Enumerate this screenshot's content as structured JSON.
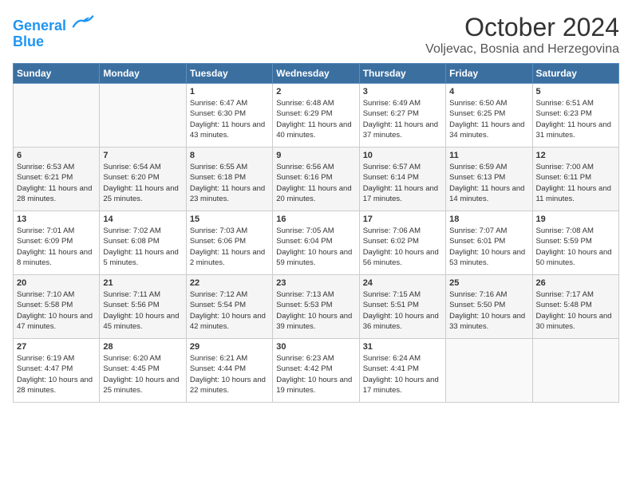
{
  "logo": {
    "line1": "General",
    "line2": "Blue"
  },
  "title": "October 2024",
  "location": "Voljevac, Bosnia and Herzegovina",
  "weekdays": [
    "Sunday",
    "Monday",
    "Tuesday",
    "Wednesday",
    "Thursday",
    "Friday",
    "Saturday"
  ],
  "weeks": [
    [
      {
        "day": "",
        "sunrise": "",
        "sunset": "",
        "daylight": ""
      },
      {
        "day": "",
        "sunrise": "",
        "sunset": "",
        "daylight": ""
      },
      {
        "day": "1",
        "sunrise": "Sunrise: 6:47 AM",
        "sunset": "Sunset: 6:30 PM",
        "daylight": "Daylight: 11 hours and 43 minutes."
      },
      {
        "day": "2",
        "sunrise": "Sunrise: 6:48 AM",
        "sunset": "Sunset: 6:29 PM",
        "daylight": "Daylight: 11 hours and 40 minutes."
      },
      {
        "day": "3",
        "sunrise": "Sunrise: 6:49 AM",
        "sunset": "Sunset: 6:27 PM",
        "daylight": "Daylight: 11 hours and 37 minutes."
      },
      {
        "day": "4",
        "sunrise": "Sunrise: 6:50 AM",
        "sunset": "Sunset: 6:25 PM",
        "daylight": "Daylight: 11 hours and 34 minutes."
      },
      {
        "day": "5",
        "sunrise": "Sunrise: 6:51 AM",
        "sunset": "Sunset: 6:23 PM",
        "daylight": "Daylight: 11 hours and 31 minutes."
      }
    ],
    [
      {
        "day": "6",
        "sunrise": "Sunrise: 6:53 AM",
        "sunset": "Sunset: 6:21 PM",
        "daylight": "Daylight: 11 hours and 28 minutes."
      },
      {
        "day": "7",
        "sunrise": "Sunrise: 6:54 AM",
        "sunset": "Sunset: 6:20 PM",
        "daylight": "Daylight: 11 hours and 25 minutes."
      },
      {
        "day": "8",
        "sunrise": "Sunrise: 6:55 AM",
        "sunset": "Sunset: 6:18 PM",
        "daylight": "Daylight: 11 hours and 23 minutes."
      },
      {
        "day": "9",
        "sunrise": "Sunrise: 6:56 AM",
        "sunset": "Sunset: 6:16 PM",
        "daylight": "Daylight: 11 hours and 20 minutes."
      },
      {
        "day": "10",
        "sunrise": "Sunrise: 6:57 AM",
        "sunset": "Sunset: 6:14 PM",
        "daylight": "Daylight: 11 hours and 17 minutes."
      },
      {
        "day": "11",
        "sunrise": "Sunrise: 6:59 AM",
        "sunset": "Sunset: 6:13 PM",
        "daylight": "Daylight: 11 hours and 14 minutes."
      },
      {
        "day": "12",
        "sunrise": "Sunrise: 7:00 AM",
        "sunset": "Sunset: 6:11 PM",
        "daylight": "Daylight: 11 hours and 11 minutes."
      }
    ],
    [
      {
        "day": "13",
        "sunrise": "Sunrise: 7:01 AM",
        "sunset": "Sunset: 6:09 PM",
        "daylight": "Daylight: 11 hours and 8 minutes."
      },
      {
        "day": "14",
        "sunrise": "Sunrise: 7:02 AM",
        "sunset": "Sunset: 6:08 PM",
        "daylight": "Daylight: 11 hours and 5 minutes."
      },
      {
        "day": "15",
        "sunrise": "Sunrise: 7:03 AM",
        "sunset": "Sunset: 6:06 PM",
        "daylight": "Daylight: 11 hours and 2 minutes."
      },
      {
        "day": "16",
        "sunrise": "Sunrise: 7:05 AM",
        "sunset": "Sunset: 6:04 PM",
        "daylight": "Daylight: 10 hours and 59 minutes."
      },
      {
        "day": "17",
        "sunrise": "Sunrise: 7:06 AM",
        "sunset": "Sunset: 6:02 PM",
        "daylight": "Daylight: 10 hours and 56 minutes."
      },
      {
        "day": "18",
        "sunrise": "Sunrise: 7:07 AM",
        "sunset": "Sunset: 6:01 PM",
        "daylight": "Daylight: 10 hours and 53 minutes."
      },
      {
        "day": "19",
        "sunrise": "Sunrise: 7:08 AM",
        "sunset": "Sunset: 5:59 PM",
        "daylight": "Daylight: 10 hours and 50 minutes."
      }
    ],
    [
      {
        "day": "20",
        "sunrise": "Sunrise: 7:10 AM",
        "sunset": "Sunset: 5:58 PM",
        "daylight": "Daylight: 10 hours and 47 minutes."
      },
      {
        "day": "21",
        "sunrise": "Sunrise: 7:11 AM",
        "sunset": "Sunset: 5:56 PM",
        "daylight": "Daylight: 10 hours and 45 minutes."
      },
      {
        "day": "22",
        "sunrise": "Sunrise: 7:12 AM",
        "sunset": "Sunset: 5:54 PM",
        "daylight": "Daylight: 10 hours and 42 minutes."
      },
      {
        "day": "23",
        "sunrise": "Sunrise: 7:13 AM",
        "sunset": "Sunset: 5:53 PM",
        "daylight": "Daylight: 10 hours and 39 minutes."
      },
      {
        "day": "24",
        "sunrise": "Sunrise: 7:15 AM",
        "sunset": "Sunset: 5:51 PM",
        "daylight": "Daylight: 10 hours and 36 minutes."
      },
      {
        "day": "25",
        "sunrise": "Sunrise: 7:16 AM",
        "sunset": "Sunset: 5:50 PM",
        "daylight": "Daylight: 10 hours and 33 minutes."
      },
      {
        "day": "26",
        "sunrise": "Sunrise: 7:17 AM",
        "sunset": "Sunset: 5:48 PM",
        "daylight": "Daylight: 10 hours and 30 minutes."
      }
    ],
    [
      {
        "day": "27",
        "sunrise": "Sunrise: 6:19 AM",
        "sunset": "Sunset: 4:47 PM",
        "daylight": "Daylight: 10 hours and 28 minutes."
      },
      {
        "day": "28",
        "sunrise": "Sunrise: 6:20 AM",
        "sunset": "Sunset: 4:45 PM",
        "daylight": "Daylight: 10 hours and 25 minutes."
      },
      {
        "day": "29",
        "sunrise": "Sunrise: 6:21 AM",
        "sunset": "Sunset: 4:44 PM",
        "daylight": "Daylight: 10 hours and 22 minutes."
      },
      {
        "day": "30",
        "sunrise": "Sunrise: 6:23 AM",
        "sunset": "Sunset: 4:42 PM",
        "daylight": "Daylight: 10 hours and 19 minutes."
      },
      {
        "day": "31",
        "sunrise": "Sunrise: 6:24 AM",
        "sunset": "Sunset: 4:41 PM",
        "daylight": "Daylight: 10 hours and 17 minutes."
      },
      {
        "day": "",
        "sunrise": "",
        "sunset": "",
        "daylight": ""
      },
      {
        "day": "",
        "sunrise": "",
        "sunset": "",
        "daylight": ""
      }
    ]
  ]
}
